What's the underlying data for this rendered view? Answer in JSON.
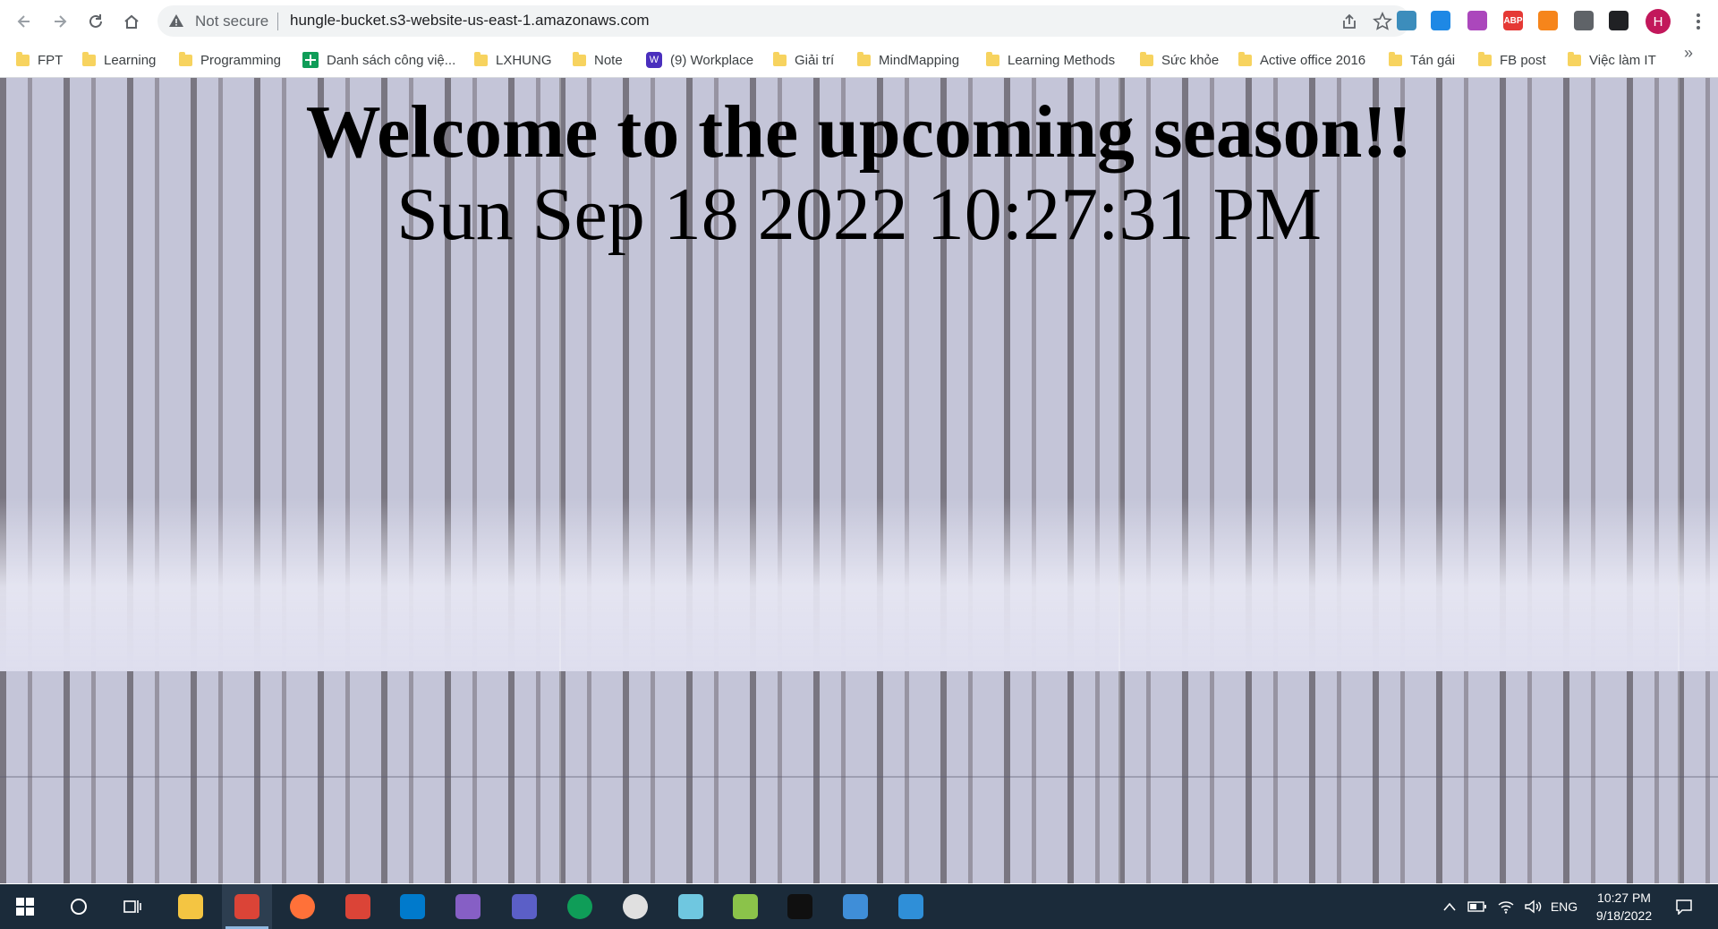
{
  "browser": {
    "security_label": "Not secure",
    "url": "hungle-bucket.s3-website-us-east-1.amazonaws.com",
    "profile_initial": "H",
    "extensions": [
      {
        "icon": "reader-extension-icon",
        "color": "#3c8dbc",
        "label": ""
      },
      {
        "icon": "water-drop-extension-icon",
        "color": "#1e88e5",
        "label": ""
      },
      {
        "icon": "pen-extension-icon",
        "color": "#ab47bc",
        "label": ""
      },
      {
        "icon": "adblock-plus-icon",
        "color": "#e53935",
        "label": "ABP"
      },
      {
        "icon": "metamask-fox-icon",
        "color": "#f6851b",
        "label": ""
      },
      {
        "icon": "puzzle-extensions-icon",
        "color": "#5f6368",
        "label": ""
      },
      {
        "icon": "side-panel-icon",
        "color": "#202124",
        "label": ""
      }
    ]
  },
  "bookmarks": [
    {
      "label": "FPT",
      "icon": "folder-icon"
    },
    {
      "label": "Learning",
      "icon": "folder-icon"
    },
    {
      "label": "Programming",
      "icon": "folder-icon"
    },
    {
      "label": "Danh sách công việ...",
      "icon": "google-sheets-icon"
    },
    {
      "label": "LXHUNG",
      "icon": "folder-icon"
    },
    {
      "label": "Note",
      "icon": "folder-icon"
    },
    {
      "label": "(9) Workplace",
      "icon": "workplace-icon"
    },
    {
      "label": "Giải trí",
      "icon": "folder-icon"
    },
    {
      "label": "MindMapping",
      "icon": "folder-icon"
    },
    {
      "label": "Learning Methods",
      "icon": "folder-icon"
    },
    {
      "label": "Sức khỏe",
      "icon": "folder-icon"
    },
    {
      "label": "Active office 2016",
      "icon": "folder-icon"
    },
    {
      "label": "Tán gái",
      "icon": "folder-icon"
    },
    {
      "label": "FB post",
      "icon": "folder-icon"
    },
    {
      "label": "Việc làm IT",
      "icon": "folder-icon"
    }
  ],
  "bookmarks_more": "»",
  "page": {
    "headline": "Welcome to the upcoming season!!",
    "datetime": "Sun Sep 18 2022 10:27:31 PM",
    "background": "snowy-forest-tiled-image"
  },
  "taskbar": {
    "apps": [
      {
        "name": "file-explorer-icon",
        "color": "#f4c542"
      },
      {
        "name": "chrome-profile-h-icon",
        "color": "#db4437",
        "active": true
      },
      {
        "name": "firefox-icon",
        "color": "#ff7139"
      },
      {
        "name": "chrome-profile-h2-icon",
        "color": "#db4437"
      },
      {
        "name": "vscode-icon",
        "color": "#007acc"
      },
      {
        "name": "visual-studio-icon",
        "color": "#865fc5"
      },
      {
        "name": "teams-icon",
        "color": "#5b5fc7"
      },
      {
        "name": "chrome-icon",
        "color": "#0f9d58"
      },
      {
        "name": "clock-app-icon",
        "color": "#e0e0e0"
      },
      {
        "name": "cube-app-icon",
        "color": "#6fc7e0"
      },
      {
        "name": "notepad-plus-icon",
        "color": "#8bc34a"
      },
      {
        "name": "terminal-icon",
        "color": "#101010"
      },
      {
        "name": "network-app-icon",
        "color": "#3f8ed8"
      },
      {
        "name": "photos-icon",
        "color": "#2f8fd8"
      }
    ],
    "language": "ENG",
    "time": "10:27 PM",
    "date": "9/18/2022"
  }
}
